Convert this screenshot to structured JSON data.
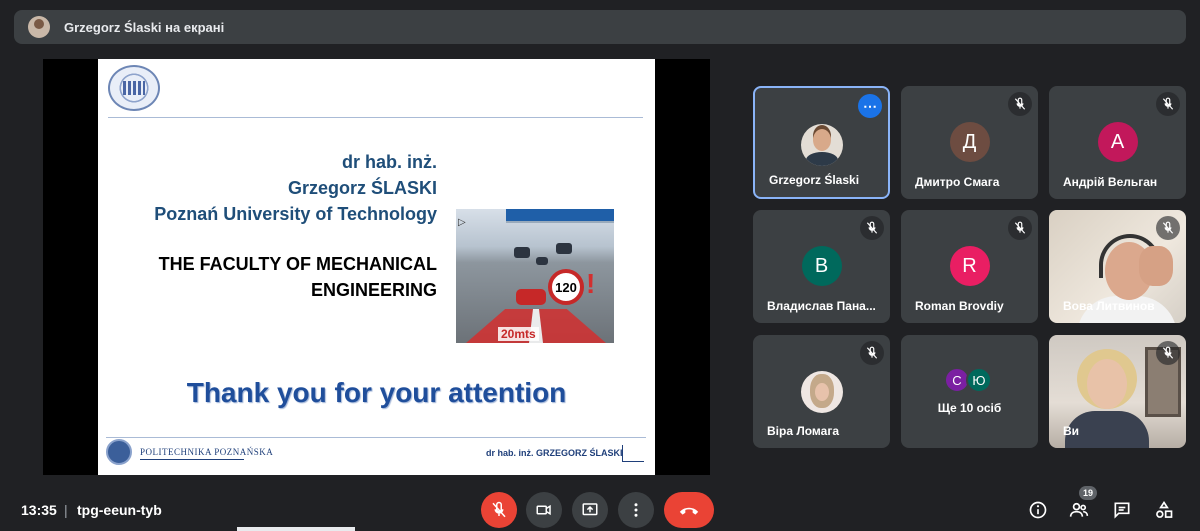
{
  "presenter_bar": {
    "text": "Grzegorz Ślaski на екрані"
  },
  "slide": {
    "name_lines": [
      "dr hab. inż.",
      "Grzegorz ŚLASKI",
      "Poznań University of Technology"
    ],
    "faculty_lines": [
      "THE FACULTY OF MECHANICAL",
      "ENGINEERING"
    ],
    "thanks": "Thank you for your attention",
    "speed_sign": "120",
    "distance": "20mts",
    "footer_org": "POLITECHNIKA POZNAŃSKA",
    "footer_name": "dr hab. inż. GRZEGORZ ŚLASKI"
  },
  "participants": [
    {
      "name": "Grzegorz Ślaski",
      "type": "photo",
      "active": true
    },
    {
      "name": "Дмитро Смага",
      "initial": "Д",
      "color": "#6d4c41",
      "muted": true
    },
    {
      "name": "Андрій Вельган",
      "initial": "А",
      "color": "#c2185b",
      "muted": true
    },
    {
      "name": "Владислав Пана...",
      "initial": "В",
      "color": "#00695c",
      "muted": true
    },
    {
      "name": "Roman Brovdiy",
      "initial": "R",
      "color": "#e91e63",
      "muted": true
    },
    {
      "name": "Вова Литвинов",
      "type": "video",
      "muted": true
    },
    {
      "name": "Віра Ломага",
      "type": "photo",
      "muted": true
    },
    {
      "more_label": "Ще 10 осіб",
      "initials": [
        "С",
        "Ю"
      ]
    },
    {
      "name": "Ви",
      "type": "video",
      "muted": true
    }
  ],
  "bottom_bar": {
    "time": "13:35",
    "separator": "|",
    "meeting_code": "tpg-eeun-tyb",
    "people_count": "19"
  },
  "colors": {
    "background": "#202124",
    "tile": "#3c4043",
    "active_border": "#8ab4f8",
    "danger": "#ea4335"
  }
}
